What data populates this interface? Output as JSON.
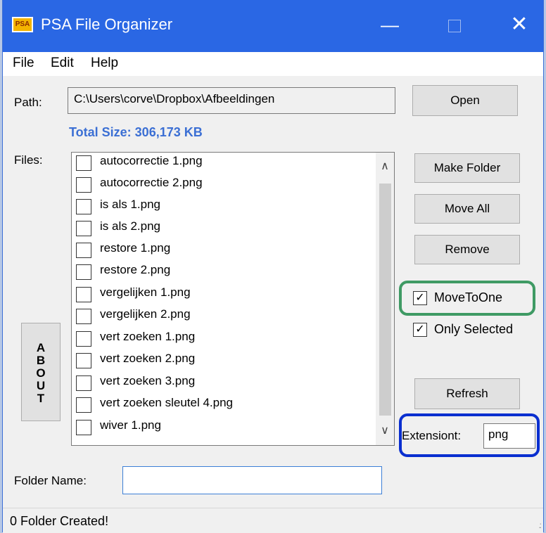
{
  "window": {
    "title": "PSA File Organizer",
    "icon_label": "PSA",
    "minimize": "—",
    "close": "✕"
  },
  "menu": {
    "file": "File",
    "edit": "Edit",
    "help": "Help"
  },
  "path": {
    "label": "Path:",
    "value": "C:\\Users\\corve\\Dropbox\\Afbeeldingen",
    "open_button": "Open"
  },
  "total_size": "Total Size: 306,173 KB",
  "files": {
    "label": "Files:",
    "items": [
      "autocorrectie 1.png",
      "autocorrectie 2.png",
      "is als 1.png",
      "is als 2.png",
      "restore 1.png",
      "restore 2.png",
      "vergelijken 1.png",
      "vergelijken 2.png",
      "vert zoeken 1.png",
      "vert zoeken 2.png",
      "vert zoeken 3.png",
      "vert zoeken sleutel 4.png",
      "wiver 1.png"
    ],
    "scroll_up": "∧",
    "scroll_down": "∨"
  },
  "buttons": {
    "make_folder": "Make Folder",
    "move_all": "Move All",
    "remove": "Remove",
    "refresh": "Refresh",
    "about_letters": [
      "A",
      "B",
      "O",
      "U",
      "T"
    ]
  },
  "options": {
    "move_to_one": {
      "label": "MoveToOne",
      "checked": "✓"
    },
    "only_selected": {
      "label": "Only Selected",
      "checked": "✓"
    }
  },
  "extension": {
    "label": "Extensiont:",
    "value": "png"
  },
  "folder_name": {
    "label": "Folder Name:",
    "value": ""
  },
  "status": {
    "text": "0 Folder Created!",
    "grip": ".:"
  },
  "colors": {
    "titlebar": "#2a67e4",
    "total_size": "#3b6fd4",
    "highlight_green": "#3f9a64",
    "highlight_blue": "#0a2fd0"
  }
}
